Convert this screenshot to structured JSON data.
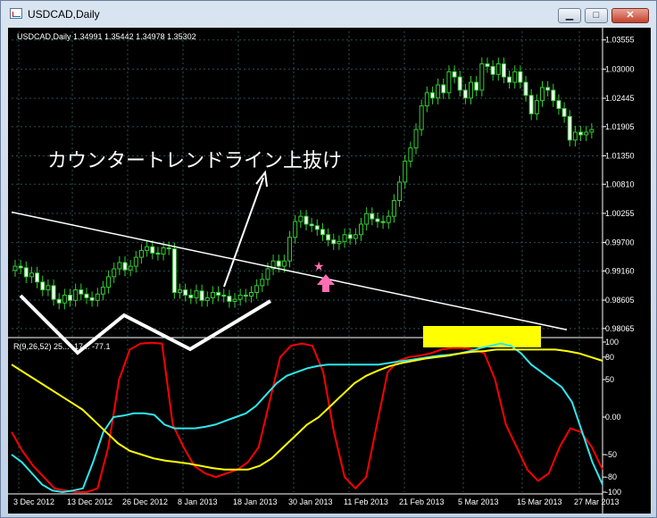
{
  "window": {
    "title": "USDCAD,Daily",
    "buttons": {
      "minimize": "▁",
      "maximize": "□",
      "close": "✕"
    }
  },
  "chart_data": {
    "type": "candlestick",
    "header": "USDCAD,Daily  1.34991 1.35442 1.34978 1.35302",
    "ylim": [
      0.9796,
      1.0372
    ],
    "price_ticks": [
      "1.03555",
      "1.03000",
      "1.02445",
      "1.01905",
      "1.01350",
      "1.00810",
      "1.00255",
      "0.99700",
      "0.99160",
      "0.98605",
      "0.98065"
    ],
    "date_ticks": [
      "3 Dec 2012",
      "13 Dec 2012",
      "26 Dec 2012",
      "8 Jan 2013",
      "18 Jan 2013",
      "30 Jan 2013",
      "11 Feb 2013",
      "21 Feb 2013",
      "5 Mar 2013",
      "15 Mar 2013",
      "27 Mar 2013"
    ],
    "closes": [
      0.9925,
      0.9922,
      0.9905,
      0.9912,
      0.9895,
      0.988,
      0.9888,
      0.9862,
      0.9855,
      0.987,
      0.986,
      0.988,
      0.9872,
      0.9865,
      0.986,
      0.9872,
      0.9885,
      0.9905,
      0.992,
      0.9932,
      0.9918,
      0.9925,
      0.9942,
      0.9955,
      0.9962,
      0.995,
      0.9948,
      0.996,
      0.9958,
      0.9875,
      0.988,
      0.987,
      0.9865,
      0.9878,
      0.986,
      0.9865,
      0.9875,
      0.987,
      0.9868,
      0.9858,
      0.9862,
      0.987,
      0.9868,
      0.9875,
      0.9888,
      0.99,
      0.992,
      0.9935,
      0.9925,
      0.9935,
      0.998,
      1.001,
      1.002,
      1.0005,
      1.0002,
      0.9995,
      0.9985,
      0.9975,
      0.9968,
      0.9972,
      0.9985,
      0.9978,
      0.9985,
      1.0005,
      1.0025,
      1.0015,
      1.001,
      1.0008,
      1.002,
      1.005,
      1.0085,
      1.0125,
      1.015,
      1.0185,
      1.023,
      1.0255,
      1.0245,
      1.027,
      1.0255,
      1.0295,
      1.0285,
      1.026,
      1.0245,
      1.0275,
      1.026,
      1.031,
      1.0305,
      1.029,
      1.031,
      1.0285,
      1.0275,
      1.0295,
      1.0275,
      1.025,
      1.0215,
      1.024,
      1.0265,
      1.026,
      1.024,
      1.0225,
      1.021,
      1.0165,
      1.018,
      1.0175,
      1.018,
      1.0185
    ],
    "trendline": {
      "from": [
        "3 Dec 2012",
        1.0028
      ],
      "to": [
        "27 Mar 2013",
        0.9804
      ]
    },
    "indicator": {
      "label": "R(9,26,52) 25... -17... -77.1",
      "ylim": [
        -100,
        100
      ],
      "ticks": [
        "100",
        "80",
        "50",
        "0.00",
        "-50",
        "-80",
        "-100"
      ],
      "series": [
        {
          "color": "#ff0000",
          "values": [
            -20,
            -45,
            -65,
            -80,
            -95,
            -98,
            -100,
            -100,
            -95,
            -40,
            50,
            90,
            98,
            99,
            98,
            -10,
            -40,
            -65,
            -75,
            -80,
            -75,
            -70,
            -60,
            -40,
            20,
            80,
            95,
            98,
            95,
            60,
            -20,
            -80,
            -95,
            -80,
            -10,
            60,
            75,
            80,
            82,
            85,
            90,
            92,
            92,
            90,
            85,
            50,
            -10,
            -40,
            -70,
            -85,
            -75,
            -40,
            -15,
            -20,
            -40,
            -70
          ]
        },
        {
          "color": "#2ee8ee",
          "values": [
            -50,
            -60,
            -75,
            -90,
            -98,
            -100,
            -98,
            -95,
            -60,
            -20,
            0,
            2,
            5,
            5,
            3,
            -10,
            -15,
            -15,
            -15,
            -13,
            -10,
            -5,
            0,
            5,
            15,
            30,
            45,
            55,
            60,
            65,
            68,
            70,
            70,
            70,
            70,
            70,
            70,
            72,
            74,
            76,
            78,
            80,
            82,
            83,
            85,
            88,
            92,
            95,
            98,
            95,
            85,
            70,
            60,
            50,
            40,
            20,
            -20,
            -60,
            -90
          ]
        },
        {
          "color": "#ffff00",
          "values": [
            70,
            60,
            50,
            40,
            30,
            20,
            10,
            -5,
            -20,
            -35,
            -45,
            -50,
            -55,
            -58,
            -60,
            -62,
            -65,
            -68,
            -70,
            -70,
            -70,
            -65,
            -55,
            -40,
            -25,
            -10,
            0,
            15,
            30,
            45,
            55,
            62,
            68,
            72,
            75,
            78,
            80,
            82,
            85,
            87,
            88,
            90,
            90,
            90,
            90,
            90,
            90,
            88,
            85,
            80,
            75
          ]
        }
      ]
    }
  },
  "annotation": {
    "label": "カウンタートレンドライン上抜け",
    "star": "★"
  },
  "colors": {
    "bg": "#000000",
    "grid": "#2f4f4f",
    "candle": "#32cd32",
    "bear": "#000000",
    "highlight": "#ffff00",
    "arrow": "#ff6eb4",
    "zigzag": "#ffffff"
  }
}
